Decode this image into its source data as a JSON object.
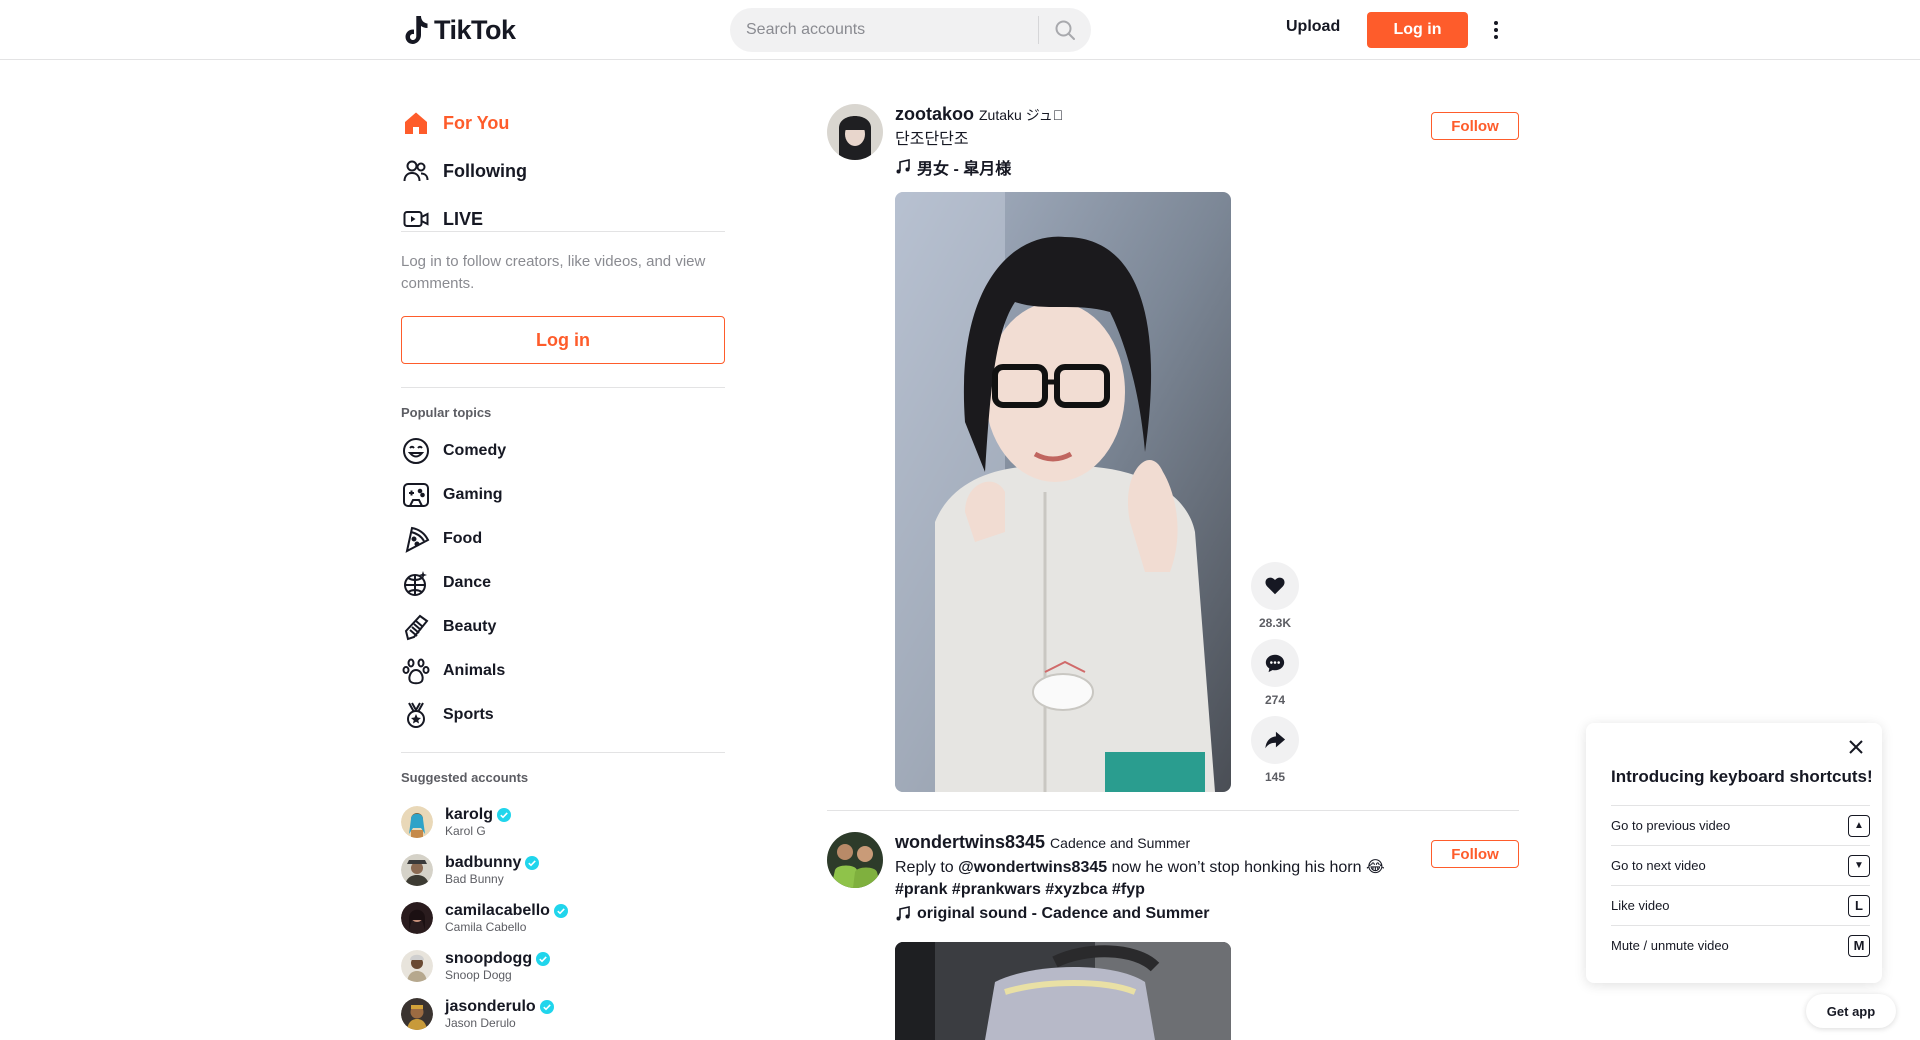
{
  "header": {
    "logo_text": "TikTok",
    "search_placeholder": "Search accounts",
    "upload_label": "Upload",
    "login_label": "Log in"
  },
  "sidebar": {
    "nav": [
      {
        "label": "For You",
        "icon": "home-icon",
        "active": true
      },
      {
        "label": "Following",
        "icon": "people-icon"
      },
      {
        "label": "LIVE",
        "icon": "live-camera-icon"
      }
    ],
    "login_hint": "Log in to follow creators, like videos, and view comments.",
    "login_button": "Log in",
    "popular_topics_title": "Popular topics",
    "topics": [
      {
        "label": "Comedy",
        "icon": "comedy-icon"
      },
      {
        "label": "Gaming",
        "icon": "gamepad-icon"
      },
      {
        "label": "Food",
        "icon": "pizza-icon"
      },
      {
        "label": "Dance",
        "icon": "disco-ball-icon"
      },
      {
        "label": "Beauty",
        "icon": "comb-icon"
      },
      {
        "label": "Animals",
        "icon": "paw-icon"
      },
      {
        "label": "Sports",
        "icon": "medal-icon"
      }
    ],
    "suggested_title": "Suggested accounts",
    "accounts": [
      {
        "username": "karolg",
        "name": "Karol G",
        "verified": true
      },
      {
        "username": "badbunny",
        "name": "Bad Bunny",
        "verified": true
      },
      {
        "username": "camilacabello",
        "name": "Camila Cabello",
        "verified": true
      },
      {
        "username": "snoopdogg",
        "name": "Snoop Dogg",
        "verified": true
      },
      {
        "username": "jasonderulo",
        "name": "Jason Derulo",
        "verified": true
      }
    ]
  },
  "feed": [
    {
      "author": "zootakoo",
      "nickname": "Zutaku ジュ\u0000",
      "caption": "단조단단조",
      "music": "男女 - 皐月様",
      "follow_label": "Follow",
      "likes": "28.3K",
      "comments": "274",
      "shares": "145"
    },
    {
      "author": "wondertwins8345",
      "nickname": "Cadence and Summer",
      "caption_prefix": "Reply to",
      "mention": "@wondertwins8345",
      "caption_text": "now he won’t stop honking his horn 😂",
      "hashtags": "#prank #prankwars #xyzbca #fyp",
      "music": "original sound - Cadence and Summer",
      "follow_label": "Follow"
    }
  ],
  "shortcuts": {
    "title": "Introducing keyboard shortcuts!",
    "items": [
      {
        "label": "Go to previous video",
        "key": "▲"
      },
      {
        "label": "Go to next video",
        "key": "▼"
      },
      {
        "label": "Like video",
        "key": "L"
      },
      {
        "label": "Mute / unmute video",
        "key": "M"
      }
    ]
  },
  "get_app_label": "Get app",
  "colors": {
    "accent": "#fe5c2b",
    "text": "#161823",
    "muted": "#8a8b91",
    "verified": "#20d5ec"
  }
}
